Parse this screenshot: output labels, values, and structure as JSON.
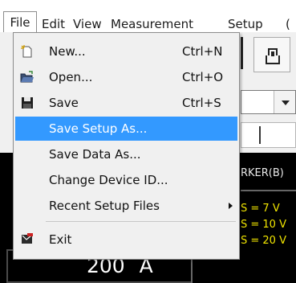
{
  "menubar": {
    "items": [
      "File",
      "Edit",
      "View",
      "Measurement",
      "Setup",
      "("
    ]
  },
  "file_menu": {
    "items": [
      {
        "label": "New...",
        "shortcut": "Ctrl+N",
        "icon": "new-file-icon"
      },
      {
        "label": "Open...",
        "shortcut": "Ctrl+O",
        "icon": "open-folder-icon"
      },
      {
        "label": "Save",
        "shortcut": "Ctrl+S",
        "icon": "save-disk-icon"
      },
      {
        "label": "Save Setup As...",
        "shortcut": "",
        "highlighted": true
      },
      {
        "label": "Save Data As...",
        "shortcut": ""
      },
      {
        "label": "Change Device ID...",
        "shortcut": ""
      },
      {
        "label": "Recent Setup Files",
        "shortcut": "",
        "submenu": true
      },
      {
        "label": "Exit",
        "shortcut": "",
        "icon": "exit-icon"
      }
    ],
    "highlight_color": "#3399ff"
  },
  "background": {
    "marker_title": "RKER(B)",
    "marker_lines": [
      "S = 7 V",
      "S = 10 V",
      "S = 20 V"
    ],
    "readout_value": "200",
    "readout_unit": "A",
    "marker_color": "#f2e600"
  }
}
